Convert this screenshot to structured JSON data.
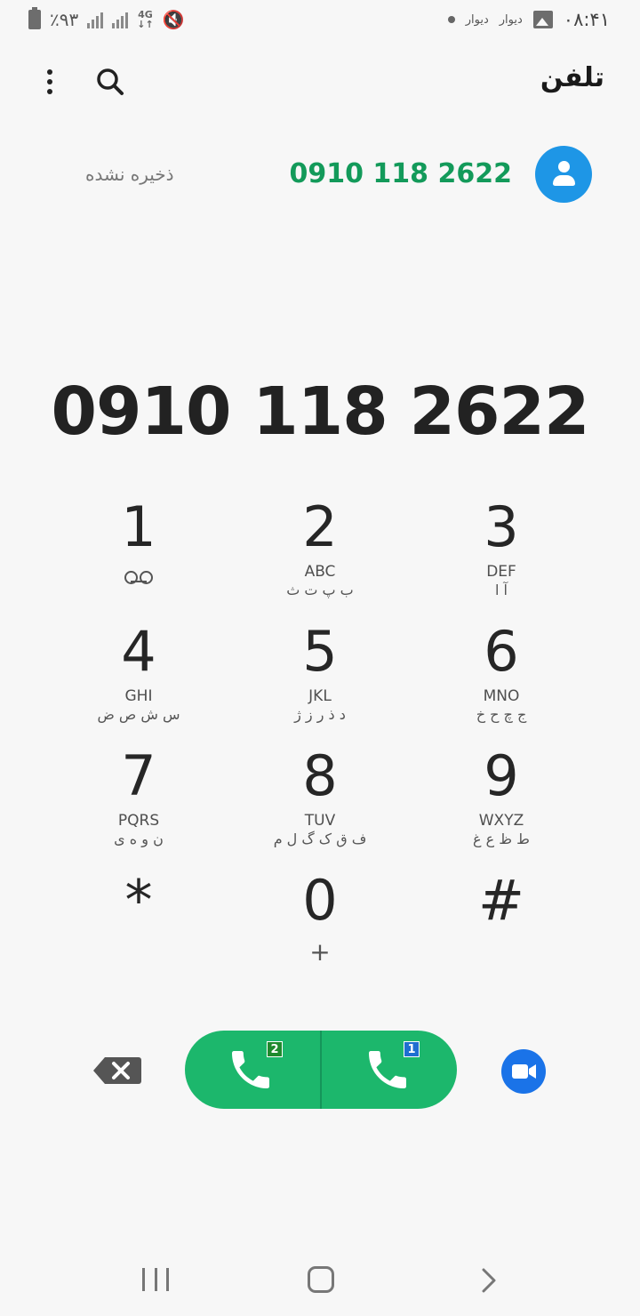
{
  "status_bar": {
    "battery": "٪۹۳",
    "network": "4G",
    "notif_app_1": "دیوار",
    "notif_app_2": "دیوار",
    "time": "۰۸:۴۱"
  },
  "app_bar": {
    "title": "تلفن"
  },
  "suggestion": {
    "number": "0910 118 2622",
    "label": "ذخیره نشده"
  },
  "dialed_number": "0910 118 2622",
  "keypad": {
    "keys": [
      {
        "digit": "1",
        "letters": "",
        "fa": ""
      },
      {
        "digit": "2",
        "letters": "ABC",
        "fa": "ب پ ت ث"
      },
      {
        "digit": "3",
        "letters": "DEF",
        "fa": "آ ا"
      },
      {
        "digit": "4",
        "letters": "GHI",
        "fa": "س ش ص ض"
      },
      {
        "digit": "5",
        "letters": "JKL",
        "fa": "د ذ ر ز ژ"
      },
      {
        "digit": "6",
        "letters": "MNO",
        "fa": "ج چ ح خ"
      },
      {
        "digit": "7",
        "letters": "PQRS",
        "fa": "ن و ه ی"
      },
      {
        "digit": "8",
        "letters": "TUV",
        "fa": "ف ق ک گ ل م"
      },
      {
        "digit": "9",
        "letters": "WXYZ",
        "fa": "ط ظ ع غ"
      },
      {
        "digit": "*",
        "letters": "",
        "fa": ""
      },
      {
        "digit": "0",
        "letters": "",
        "fa": "",
        "sub": "+"
      },
      {
        "digit": "#",
        "letters": "",
        "fa": ""
      }
    ]
  },
  "call": {
    "sim_left": "2",
    "sim_right": "1",
    "sim_left_color": "#1f8a2e",
    "sim_right_color": "#1e6fd0",
    "pill_color": "#1cb76c"
  },
  "colors": {
    "accent_green": "#139a5a",
    "avatar_blue": "#1e96e6",
    "video_blue": "#1a73e8"
  }
}
